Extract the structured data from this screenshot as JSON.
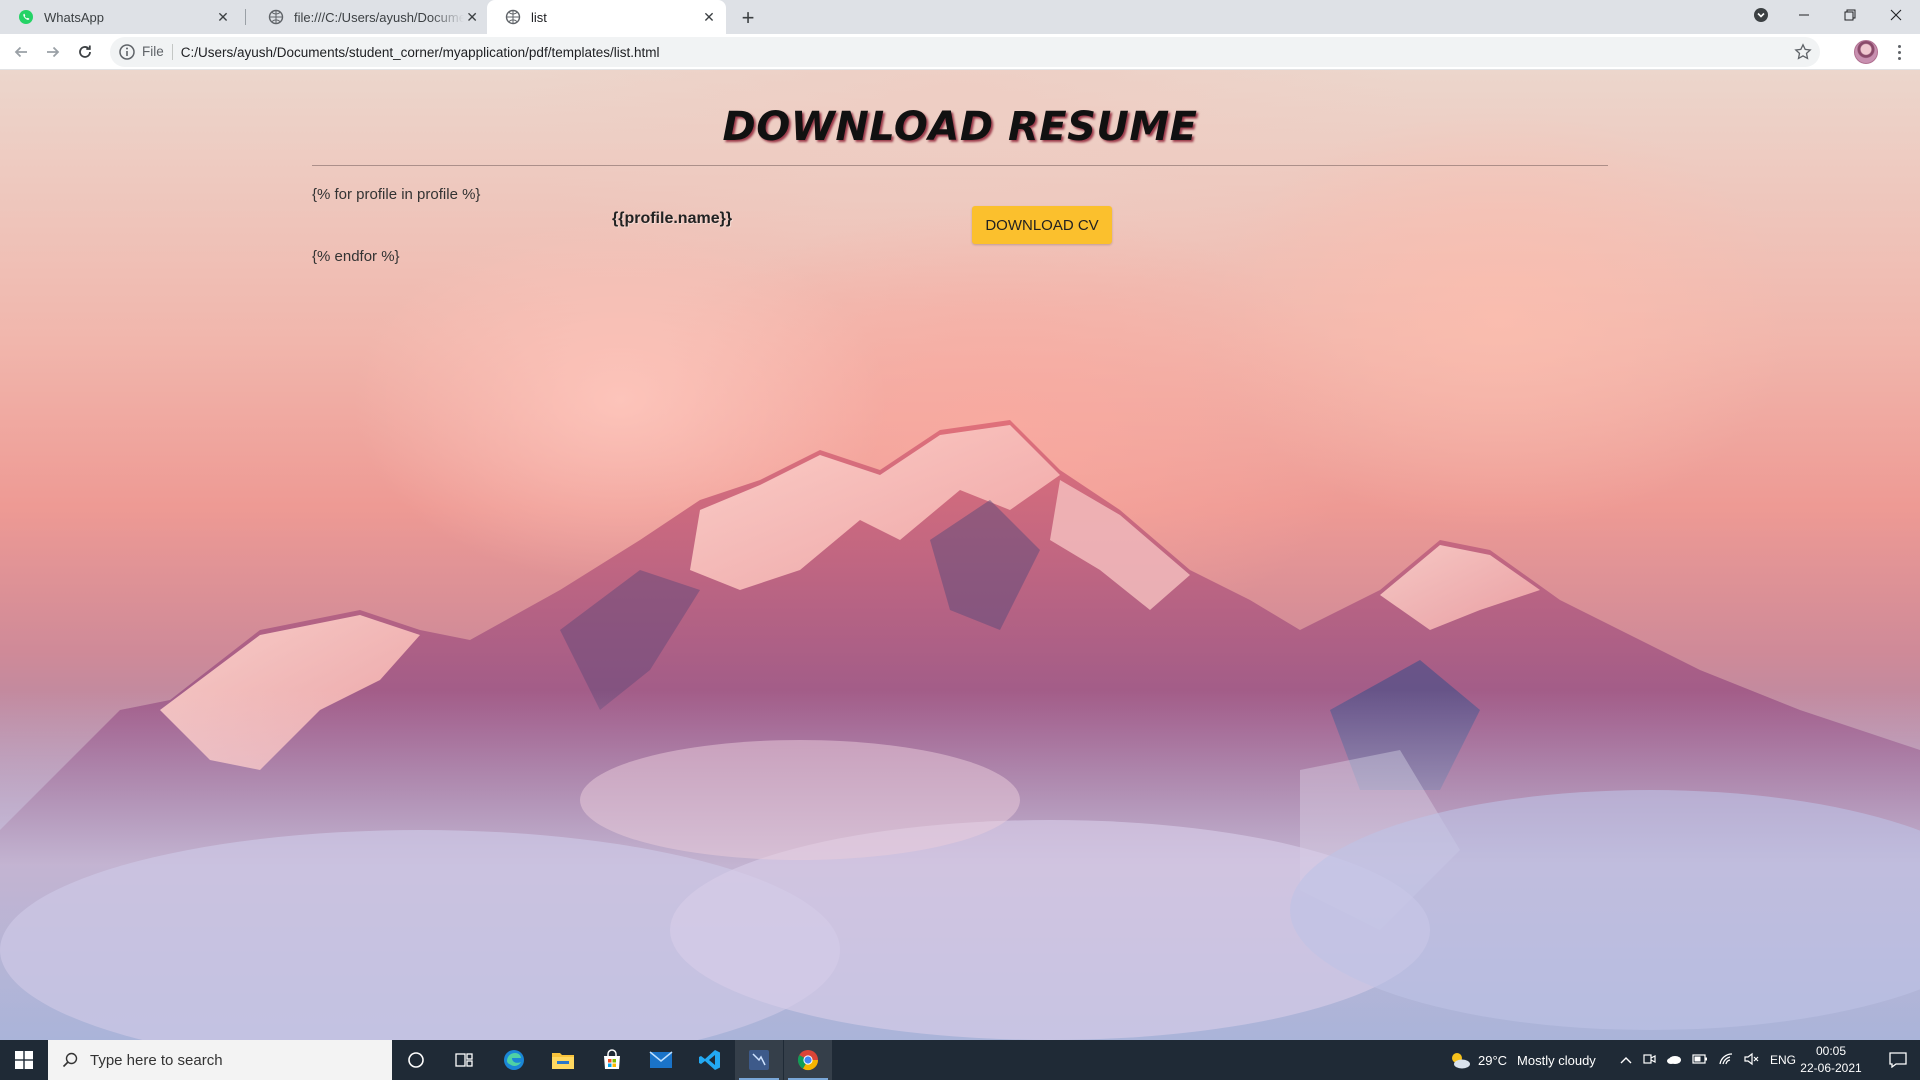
{
  "browser": {
    "tabs": [
      {
        "title": "WhatsApp",
        "favicon": "whatsapp-icon",
        "active": false
      },
      {
        "title": "file:///C:/Users/ayush/Documents/student_corner",
        "favicon": "globe-icon",
        "active": false
      },
      {
        "title": "list",
        "favicon": "globe-icon",
        "active": true
      }
    ],
    "address_bar": {
      "scheme_label": "File",
      "url": "C:/Users/ayush/Documents/student_corner/myapplication/pdf/templates/list.html"
    },
    "accent_color": "#dee1e6"
  },
  "page": {
    "title": "DOWNLOAD RESUME",
    "loop_start": "{% for profile in profile %}",
    "profile_name": "{{profile.name}}",
    "download_button": "DOWNLOAD CV",
    "loop_end": "{% endfor %}",
    "button_color": "#fbc02d"
  },
  "taskbar": {
    "search_placeholder": "Type here to search",
    "pinned": [
      "cortana-icon",
      "task-view-icon",
      "edge-icon",
      "file-explorer-icon",
      "store-icon",
      "mail-icon",
      "vscode-icon",
      "app-icon",
      "chrome-icon"
    ],
    "weather": {
      "temperature": "29°C",
      "condition": "Mostly cloudy"
    },
    "language": "ENG",
    "time": "00:05",
    "date": "22-06-2021"
  }
}
